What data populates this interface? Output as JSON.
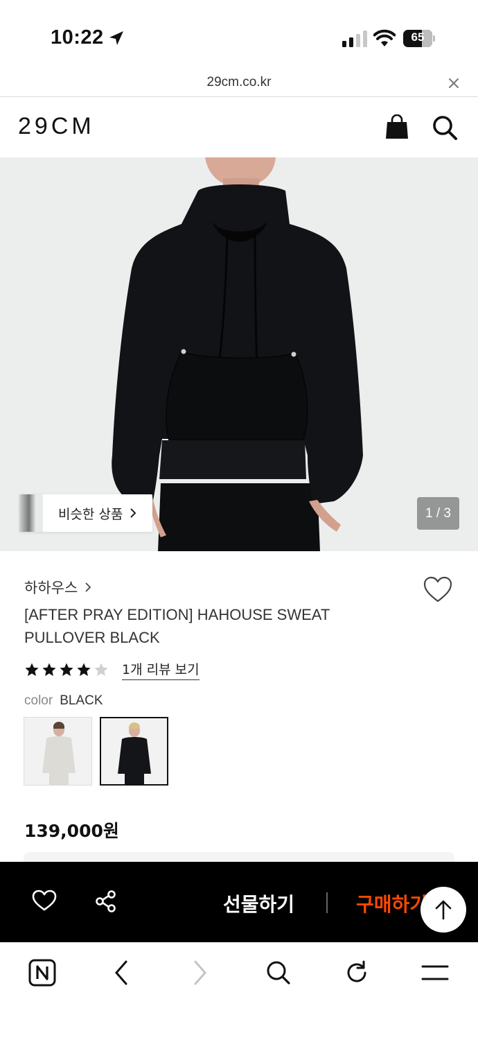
{
  "status_bar": {
    "time": "10:22",
    "battery_level": "65"
  },
  "browser": {
    "url": "29cm.co.kr"
  },
  "site_header": {
    "logo": "29CM"
  },
  "product_image": {
    "similar_products_label": "비슷한 상품",
    "pager": "1 / 3"
  },
  "product": {
    "brand": "하하우스",
    "title": "[AFTER PRAY EDITION] HAHOUSE SWEAT PULLOVER BLACK",
    "rating": 4,
    "rating_max": 5,
    "review_link": "1개 리뷰 보기",
    "color_label": "color",
    "color_value": "BLACK",
    "color_options": [
      {
        "name": "light gray",
        "selected": false
      },
      {
        "name": "black",
        "selected": true
      }
    ],
    "price": "139,000원"
  },
  "purchase_bar": {
    "gift_label": "선물하기",
    "buy_label": "구매하기"
  },
  "colors": {
    "accent": "#ff4800",
    "purchase_bar_bg": "#000000"
  }
}
